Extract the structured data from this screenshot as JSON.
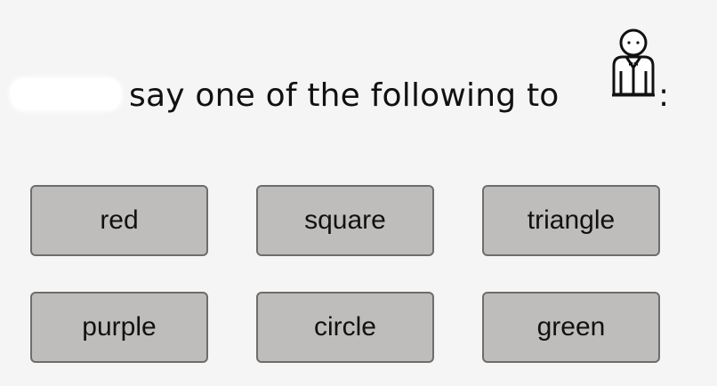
{
  "prompt": {
    "text": "say one of the following to",
    "colon": ":",
    "recipient_icon": "person-icon"
  },
  "choices": [
    {
      "label": "red"
    },
    {
      "label": "square"
    },
    {
      "label": "triangle"
    },
    {
      "label": "purple"
    },
    {
      "label": "circle"
    },
    {
      "label": "green"
    }
  ],
  "colors": {
    "background": "#f5f5f5",
    "button_fill": "#bfbdbc",
    "button_border": "#6f6d6c",
    "text": "#111111"
  }
}
